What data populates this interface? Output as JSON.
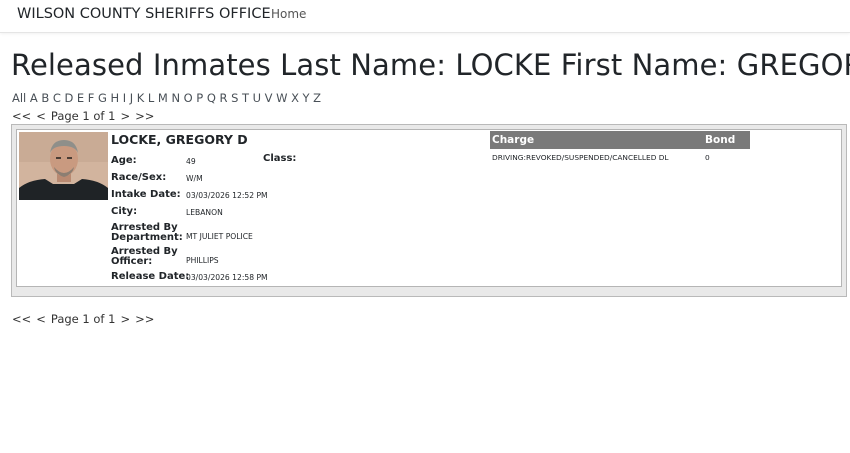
{
  "nav": {
    "brand": "WILSON COUNTY SHERIFFS OFFICE",
    "home": "Home"
  },
  "page": {
    "title": "Released Inmates Last Name: LOCKE First Name: GREGORY"
  },
  "alphabet": [
    "All",
    "A",
    "B",
    "C",
    "D",
    "E",
    "F",
    "G",
    "H",
    "I",
    "J",
    "K",
    "L",
    "M",
    "N",
    "O",
    "P",
    "Q",
    "R",
    "S",
    "T",
    "U",
    "V",
    "W",
    "X",
    "Y",
    "Z"
  ],
  "pager": {
    "first": "<<",
    "prev": "<",
    "label": "Page 1 of 1",
    "next": ">",
    "last": ">>"
  },
  "inmate": {
    "name": "LOCKE, GREGORY D",
    "age_label": "Age:",
    "age": "49",
    "class_label": "Class:",
    "race_sex_label": "Race/Sex:",
    "race_sex": "W/M",
    "intake_label": "Intake Date:",
    "intake_date": "03/03/2026 12:52 PM",
    "city_label": "City:",
    "city": "LEBANON",
    "arrested_dept_label_1": "Arrested By",
    "arrested_dept_label_2": "Department:",
    "arrested_dept": "MT JULIET POLICE",
    "arrested_officer_label_1": "Arrested By",
    "arrested_officer_label_2": "Officer:",
    "arrested_officer": "PHILLIPS",
    "release_label": "Release Date:",
    "release_date": "03/03/2026 12:58 PM"
  },
  "charges": {
    "header_charge": "Charge",
    "header_bond": "Bond",
    "rows": [
      {
        "charge": "DRIVING:REVOKED/SUSPENDED/CANCELLED DL",
        "bond": "0"
      }
    ]
  },
  "colors": {
    "table_header_bg": "#7a7a7a",
    "outer_box_bg": "#e9e9e9"
  }
}
